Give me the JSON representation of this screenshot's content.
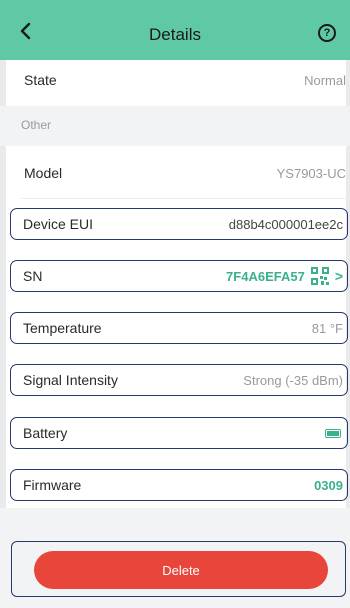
{
  "header": {
    "title": "Details"
  },
  "state": {
    "label": "State",
    "value": "Normal"
  },
  "section": {
    "label": "Other"
  },
  "rows": {
    "model": {
      "label": "Model",
      "value": "YS7903-UC"
    },
    "device_eui": {
      "label": "Device EUI",
      "value": "d88b4c000001ee2c"
    },
    "sn": {
      "label": "SN",
      "value": "7F4A6EFA57"
    },
    "temperature": {
      "label": "Temperature",
      "value": "81 °F"
    },
    "signal": {
      "label": "Signal Intensity",
      "value": "Strong (-35 dBm)"
    },
    "battery": {
      "label": "Battery",
      "level_percent": 100
    },
    "firmware": {
      "label": "Firmware",
      "value": "0309"
    }
  },
  "actions": {
    "delete_label": "Delete"
  },
  "icons": [
    "back-arrow-icon",
    "help-icon",
    "qr-code-icon",
    "chevron-right-icon",
    "battery-icon"
  ],
  "colors": {
    "header": "#5fc9a6",
    "accent": "#3bb08f",
    "danger": "#e8463a",
    "outline": "#243b6b"
  }
}
